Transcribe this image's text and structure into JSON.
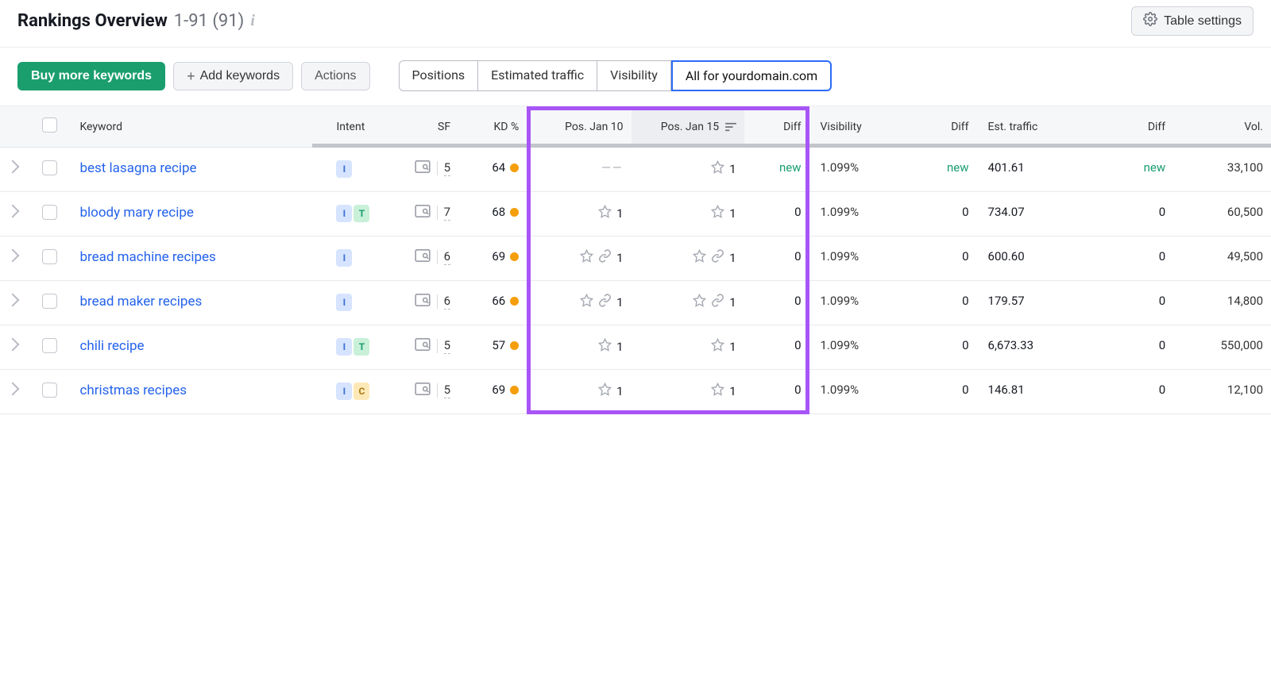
{
  "header": {
    "title": "Rankings Overview",
    "range": "1-91 (91)",
    "table_settings_label": "Table settings"
  },
  "toolbar": {
    "buy_label": "Buy more keywords",
    "add_label": "Add keywords",
    "actions_label": "Actions",
    "segments": {
      "positions": "Positions",
      "estimated_traffic": "Estimated traffic",
      "visibility": "Visibility",
      "all_for": "All for yourdomain.com"
    }
  },
  "columns": {
    "keyword": "Keyword",
    "intent": "Intent",
    "sf": "SF",
    "kd": "KD %",
    "pos1": "Pos. Jan 10",
    "pos2": "Pos. Jan 15",
    "diff1": "Diff",
    "visibility": "Visibility",
    "diff2": "Diff",
    "est_traffic": "Est. traffic",
    "diff3": "Diff",
    "vol": "Vol."
  },
  "rows": [
    {
      "keyword": "best lasagna recipe",
      "intents": [
        "I"
      ],
      "sf": "5",
      "kd": "64",
      "pos1": {
        "dash": true
      },
      "pos2": {
        "star": true,
        "val": "1"
      },
      "diff1": {
        "val": "new",
        "green": true
      },
      "visibility": "1.099%",
      "diff2": {
        "val": "new",
        "green": true
      },
      "est_traffic": "401.61",
      "diff3": {
        "val": "new",
        "green": true
      },
      "vol": "33,100"
    },
    {
      "keyword": "bloody mary recipe",
      "intents": [
        "I",
        "T"
      ],
      "sf": "7",
      "kd": "68",
      "pos1": {
        "star": true,
        "val": "1"
      },
      "pos2": {
        "star": true,
        "val": "1"
      },
      "diff1": {
        "val": "0"
      },
      "visibility": "1.099%",
      "diff2": {
        "val": "0"
      },
      "est_traffic": "734.07",
      "diff3": {
        "val": "0"
      },
      "vol": "60,500"
    },
    {
      "keyword": "bread machine recipes",
      "intents": [
        "I"
      ],
      "sf": "6",
      "kd": "69",
      "pos1": {
        "star": true,
        "link": true,
        "val": "1"
      },
      "pos2": {
        "star": true,
        "link": true,
        "val": "1"
      },
      "diff1": {
        "val": "0"
      },
      "visibility": "1.099%",
      "diff2": {
        "val": "0"
      },
      "est_traffic": "600.60",
      "diff3": {
        "val": "0"
      },
      "vol": "49,500"
    },
    {
      "keyword": "bread maker recipes",
      "intents": [
        "I"
      ],
      "sf": "6",
      "kd": "66",
      "pos1": {
        "star": true,
        "link": true,
        "val": "1"
      },
      "pos2": {
        "star": true,
        "link": true,
        "val": "1"
      },
      "diff1": {
        "val": "0"
      },
      "visibility": "1.099%",
      "diff2": {
        "val": "0"
      },
      "est_traffic": "179.57",
      "diff3": {
        "val": "0"
      },
      "vol": "14,800"
    },
    {
      "keyword": "chili recipe",
      "intents": [
        "I",
        "T"
      ],
      "sf": "5",
      "kd": "57",
      "pos1": {
        "star": true,
        "val": "1"
      },
      "pos2": {
        "star": true,
        "val": "1"
      },
      "diff1": {
        "val": "0"
      },
      "visibility": "1.099%",
      "diff2": {
        "val": "0"
      },
      "est_traffic": "6,673.33",
      "diff3": {
        "val": "0"
      },
      "vol": "550,000"
    },
    {
      "keyword": "christmas recipes",
      "intents": [
        "I",
        "C"
      ],
      "sf": "5",
      "kd": "69",
      "pos1": {
        "star": true,
        "val": "1"
      },
      "pos2": {
        "star": true,
        "val": "1"
      },
      "diff1": {
        "val": "0"
      },
      "visibility": "1.099%",
      "diff2": {
        "val": "0"
      },
      "est_traffic": "146.81",
      "diff3": {
        "val": "0"
      },
      "vol": "12,100"
    }
  ]
}
